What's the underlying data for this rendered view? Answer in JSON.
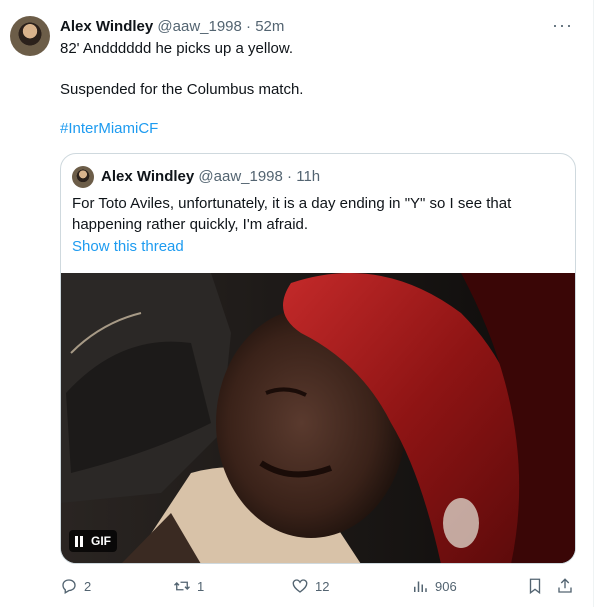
{
  "tweet": {
    "author_name": "Alex Windley",
    "author_handle": "@aaw_1998",
    "separator": "·",
    "time": "52m",
    "more": "···",
    "lines": [
      "82' Andddddd he picks up a yellow.",
      "Suspended for the Columbus match."
    ],
    "hashtag": "#InterMiamiCF"
  },
  "quote": {
    "author_name": "Alex Windley",
    "author_handle": "@aaw_1998",
    "separator": "·",
    "time": "11h",
    "lines": [
      "For Toto Aviles, unfortunately, it is a day ending in \"Y\" so I see that",
      "happening rather quickly, I'm afraid."
    ],
    "show_thread": "Show this thread",
    "media_badge": "GIF"
  },
  "actions": {
    "reply_count": "2",
    "retweet_count": "1",
    "like_count": "12",
    "views_count": "906"
  },
  "colors": {
    "text": "#0f1419",
    "secondary": "#536471",
    "link": "#1d9bf0",
    "border": "#cfd9de"
  }
}
